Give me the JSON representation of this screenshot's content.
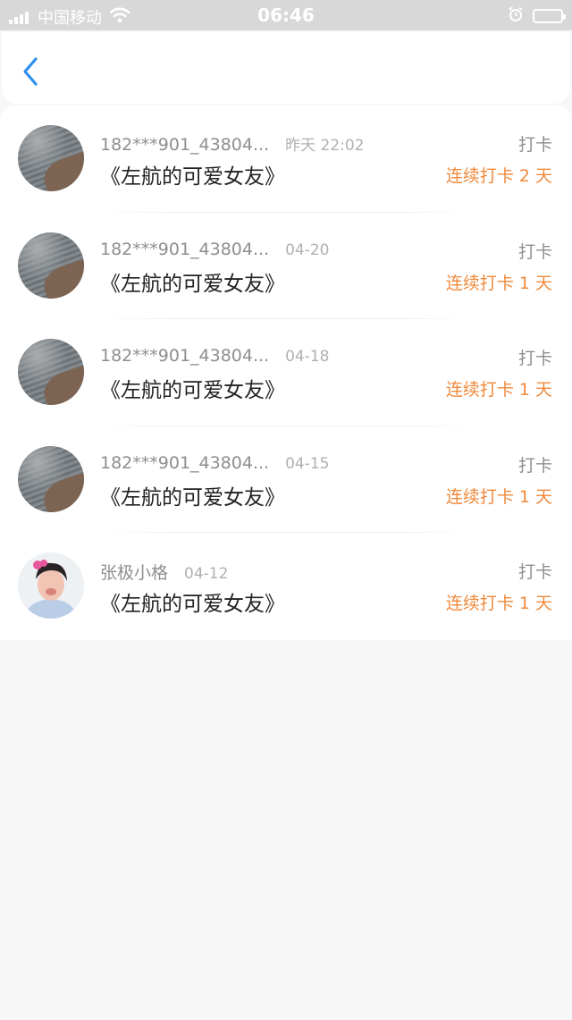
{
  "status_bar": {
    "carrier": "中国移动",
    "time": "06:46",
    "icons": [
      "signal-icon",
      "wifi-icon",
      "alarm-icon",
      "battery-icon"
    ]
  },
  "nav": {
    "back_icon": "chevron-left-icon"
  },
  "accent_color": "#f08a3c",
  "items": [
    {
      "name": "182***901_43804...",
      "date": "昨天 22:02",
      "title": "《左航的可爱女友》",
      "action": "打卡",
      "streak": "连续打卡 2 天",
      "avatar": "sea"
    },
    {
      "name": "182***901_43804...",
      "date": "04-20",
      "title": "《左航的可爱女友》",
      "action": "打卡",
      "streak": "连续打卡 1 天",
      "avatar": "sea"
    },
    {
      "name": "182***901_43804...",
      "date": "04-18",
      "title": "《左航的可爱女友》",
      "action": "打卡",
      "streak": "连续打卡 1 天",
      "avatar": "sea"
    },
    {
      "name": "182***901_43804...",
      "date": "04-15",
      "title": "《左航的可爱女友》",
      "action": "打卡",
      "streak": "连续打卡 1 天",
      "avatar": "sea"
    },
    {
      "name": "张极小格",
      "date": "04-12",
      "title": "《左航的可爱女友》",
      "action": "打卡",
      "streak": "连续打卡 1 天",
      "avatar": "person"
    }
  ]
}
